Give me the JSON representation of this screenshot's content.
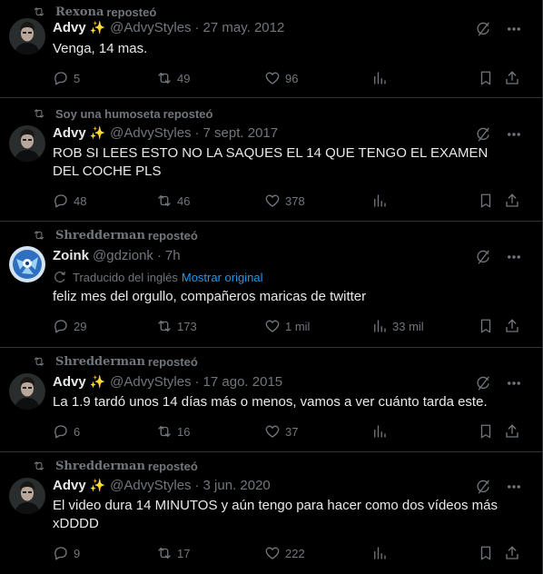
{
  "reposted_suffix": "reposteó",
  "tweets": [
    {
      "reposter": "Rexona",
      "author_name": "Advy",
      "emoji": "✨",
      "handle": "@AdvyStyles",
      "time": "27 may. 2012",
      "text": "Venga, 14 mas.",
      "replies": "5",
      "retweets": "49",
      "likes": "96",
      "views": ""
    },
    {
      "reposter": "Soy una humoseta",
      "author_name": "Advy",
      "emoji": "✨",
      "handle": "@AdvyStyles",
      "time": "7 sept. 2017",
      "text": "ROB SI LEES ESTO NO LA SAQUES EL 14 QUE TENGO EL EXAMEN DEL COCHE PLS",
      "replies": "48",
      "retweets": "46",
      "likes": "378",
      "views": ""
    },
    {
      "reposter": "Shredderman",
      "author_name": "Zoink",
      "emoji": "",
      "handle": "@gdzionk",
      "time": "7h",
      "translated_label": "Traducido del inglés",
      "show_original": "Mostrar original",
      "text": "feliz mes del orgullo, compañeros maricas de twitter",
      "replies": "29",
      "retweets": "173",
      "likes": "1 mil",
      "views": "33 mil"
    },
    {
      "reposter": "Shredderman",
      "author_name": "Advy",
      "emoji": "✨",
      "handle": "@AdvyStyles",
      "time": "17 ago. 2015",
      "text": "La 1.9 tardó unos 14 días más o menos, vamos a ver cuánto tarda este.",
      "replies": "6",
      "retweets": "16",
      "likes": "37",
      "views": ""
    },
    {
      "reposter": "Shredderman",
      "author_name": "Advy",
      "emoji": "✨",
      "handle": "@AdvyStyles",
      "time": "3 jun. 2020",
      "text": "El video dura 14 MINUTOS y aún tengo para hacer como dos vídeos más xDDDD",
      "replies": "9",
      "retweets": "17",
      "likes": "222",
      "views": ""
    }
  ]
}
